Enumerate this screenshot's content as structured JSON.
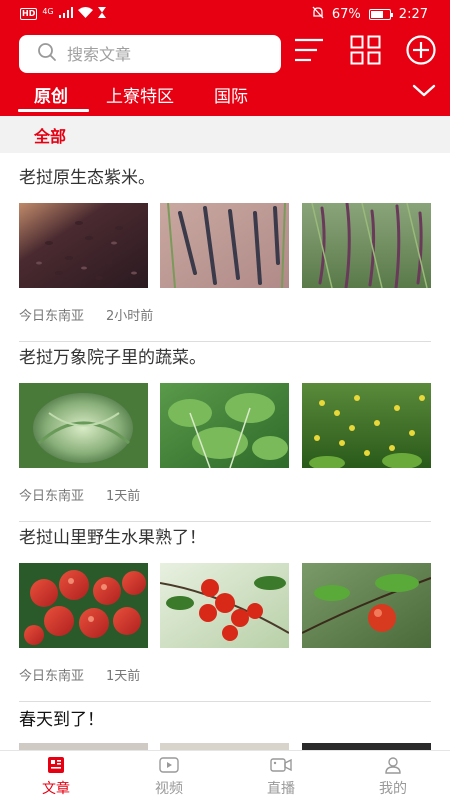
{
  "status_bar": {
    "network_badge": "HD",
    "signal": "4G",
    "battery_percent": "67%",
    "battery_level": 0.67,
    "time": "2:27"
  },
  "search": {
    "placeholder": "搜索文章"
  },
  "header_icons": [
    "menu-lines-icon",
    "grid-icon",
    "plus-circle-icon"
  ],
  "tabs": [
    {
      "label": "原创",
      "active": true
    },
    {
      "label": "上寮特区",
      "active": false
    },
    {
      "label": "国际",
      "active": false
    }
  ],
  "subfilter": {
    "label": "全部"
  },
  "articles": [
    {
      "title": "老挝原生态紫米。",
      "source": "今日东南亚",
      "time": "2小时前",
      "images": [
        "black-rice-grains-photo",
        "black-rice-in-hand-photo",
        "purple-rice-plants-photo"
      ]
    },
    {
      "title": "老挝万象院子里的蔬菜。",
      "source": "今日东南亚",
      "time": "1天前",
      "images": [
        "cabbage-photo",
        "leafy-greens-photo",
        "yellow-flowering-greens-photo"
      ]
    },
    {
      "title": "老挝山里野生水果熟了！",
      "source": "今日东南亚",
      "time": "1天前",
      "images": [
        "red-fruits-pile-photo",
        "cherries-on-branch-photo",
        "single-red-fruit-photo"
      ]
    },
    {
      "title": "春天到了！",
      "source": "",
      "time": "",
      "images": [
        "white-blossom-photo",
        "white-blossom-photo",
        "dark-blossom-photo"
      ]
    }
  ],
  "bottom_nav": [
    {
      "label": "文章",
      "icon": "article-icon",
      "active": true
    },
    {
      "label": "视频",
      "icon": "video-icon",
      "active": false
    },
    {
      "label": "直播",
      "icon": "live-camera-icon",
      "active": false
    },
    {
      "label": "我的",
      "icon": "profile-icon",
      "active": false
    }
  ],
  "colors": {
    "brand_red": "#e60012",
    "text_dark": "#333333",
    "text_meta": "#777777",
    "nav_inactive": "#999999",
    "subfilter_bg": "#f2f2f2"
  }
}
